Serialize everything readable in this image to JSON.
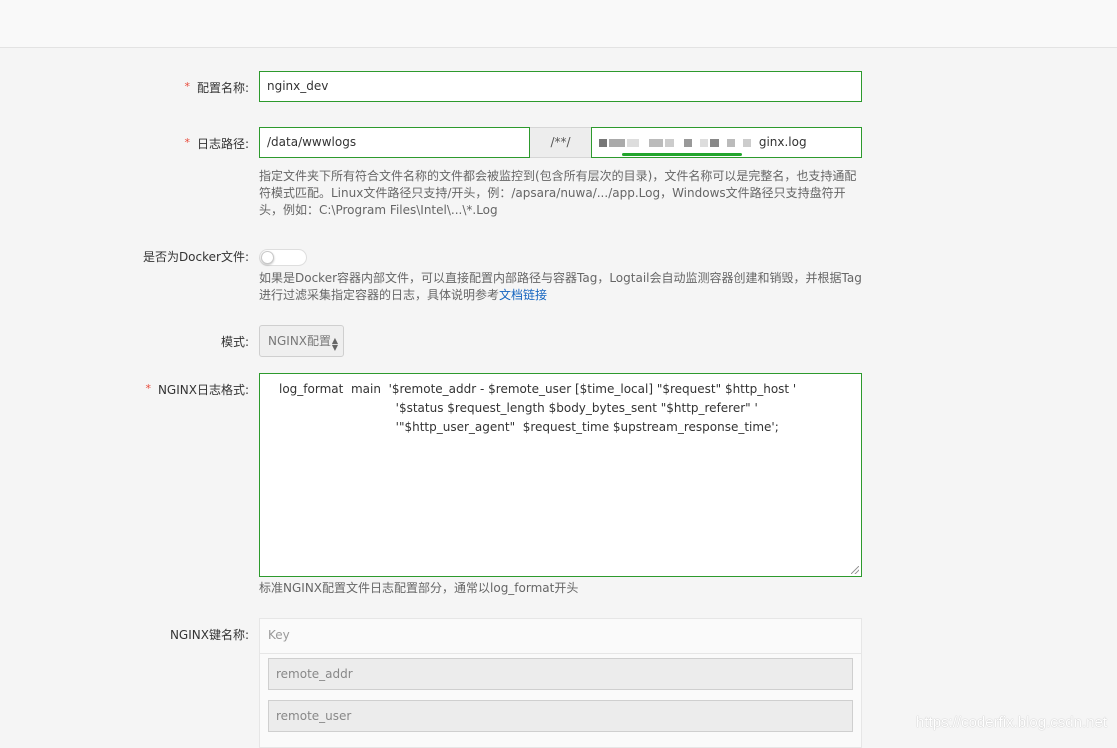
{
  "form": {
    "config_name": {
      "label": "配置名称:",
      "value": "nginx_dev",
      "required": true
    },
    "log_path": {
      "label": "日志路径:",
      "required": true,
      "dir_value": "/data/wwwlogs",
      "separator": "/**/",
      "file_value_visible": "ginx.log",
      "help": "指定文件夹下所有符合文件名称的文件都会被监控到(包含所有层次的目录)，文件名称可以是完整名，也支持通配符模式匹配。Linux文件路径只支持/开头，例：/apsara/nuwa/.../app.Log，Windows文件路径只支持盘符开头，例如：C:\\Program Files\\Intel\\...\\*.Log"
    },
    "docker": {
      "label": "是否为Docker文件:",
      "enabled": false,
      "help": "如果是Docker容器内部文件，可以直接配置内部路径与容器Tag，Logtail会自动监测容器创建和销毁，并根据Tag进行过滤采集指定容器的日志，具体说明参考",
      "help_link": "文档链接"
    },
    "mode": {
      "label": "模式:",
      "value": "NGINX配置"
    },
    "nginx_format": {
      "label": "NGINX日志格式:",
      "required": true,
      "lines": [
        "log_format  main  '$remote_addr - $remote_user [$time_local] \"$request\" $http_host '",
        "                  '$status $request_length $body_bytes_sent \"$http_referer\" '",
        "                  '\"$http_user_agent\"  $request_time $upstream_response_time';"
      ],
      "help": "标准NGINX配置文件日志配置部分，通常以log_format开头"
    },
    "nginx_keys": {
      "label": "NGINX键名称:",
      "header": "Key",
      "keys": [
        "remote_addr",
        "remote_user"
      ]
    }
  },
  "watermark": "https://coderfix.blog.csdn.net",
  "colors": {
    "accent_border": "#2d9a2d",
    "required_star": "#e84a3a",
    "link": "#1565c0"
  }
}
